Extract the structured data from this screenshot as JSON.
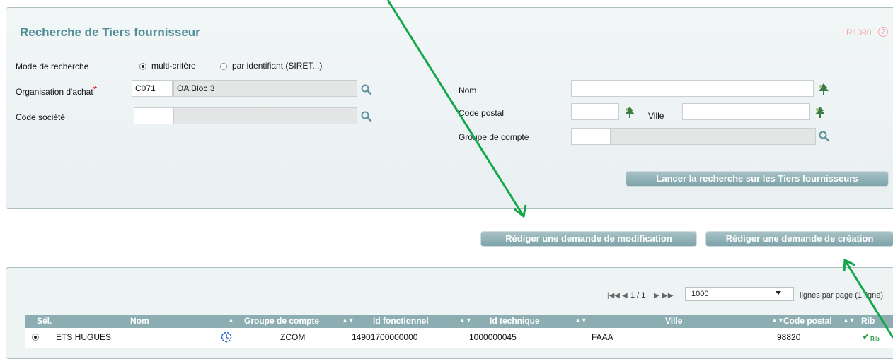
{
  "search": {
    "title": "Recherche de Tiers fournisseur",
    "code": "R1080",
    "mode_label": "Mode de recherche",
    "mode_options": [
      "multi-critère",
      "par identifiant (SIRET...)"
    ],
    "mode_selected": "multi-critère",
    "org_label": "Organisation d'achat",
    "org_required_mark": "*",
    "org_code": "C071",
    "org_name": "OA Bloc 3",
    "company_label": "Code société",
    "company_code": "",
    "company_name": "",
    "nom_label": "Nom",
    "nom_value": "",
    "postal_label": "Code postal",
    "postal_value": "",
    "ville_label": "Ville",
    "ville_value": "",
    "group_label": "Groupe de compte",
    "group_code": "",
    "group_name": "",
    "launch_button": "Lancer la recherche sur les Tiers fournisseurs"
  },
  "actions": {
    "modify_button": "Rédiger une demande de modification",
    "create_button": "Rédiger une demande de création"
  },
  "results": {
    "pager": "1 / 1",
    "per_page_value": "1000",
    "per_page_label": "lignes par page (1 ligne)",
    "columns": [
      "Sél.",
      "Nom",
      "Groupe de compte",
      "Id fonctionnel",
      "Id technique",
      "Ville",
      "Code postal",
      "Rib"
    ],
    "rows": [
      {
        "name": "ETS HUGUES",
        "group": "ZCOM",
        "id_fonctionnel": "14901700000000",
        "id_technique": "1000000045",
        "ville": "FAAA",
        "code_postal": "98820",
        "rib": "Rib"
      }
    ]
  },
  "colors": {
    "title": "#4f8e99",
    "button": "#8fb1b6",
    "table_header": "#8caeb3",
    "annotation_arrow": "#13a64a"
  }
}
